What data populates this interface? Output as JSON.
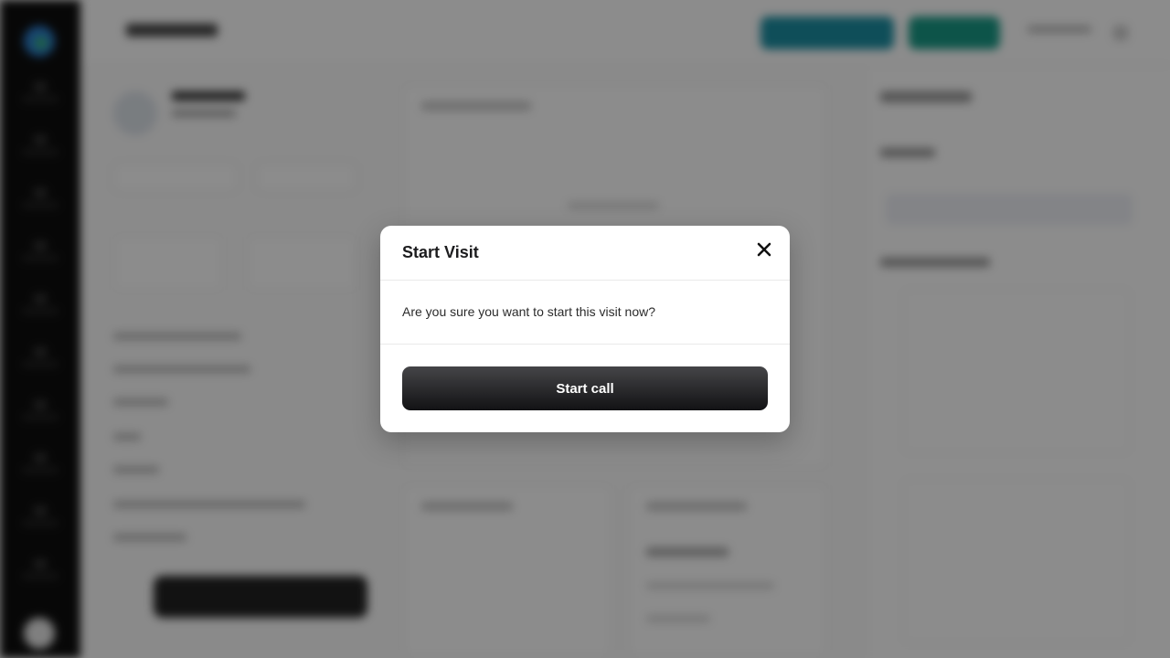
{
  "modal": {
    "title": "Start Visit",
    "message": "Are you sure you want to start this visit now?",
    "primary_button_label": "Start call",
    "close_icon": "close-icon",
    "primary_button_color": "#1c1c1e"
  },
  "background": {
    "overlay_color": "rgba(0,0,0,0.45)",
    "sidebar_color": "#0e0e0e",
    "accent_teal": "#1c8fa3",
    "accent_green": "#199a86"
  }
}
